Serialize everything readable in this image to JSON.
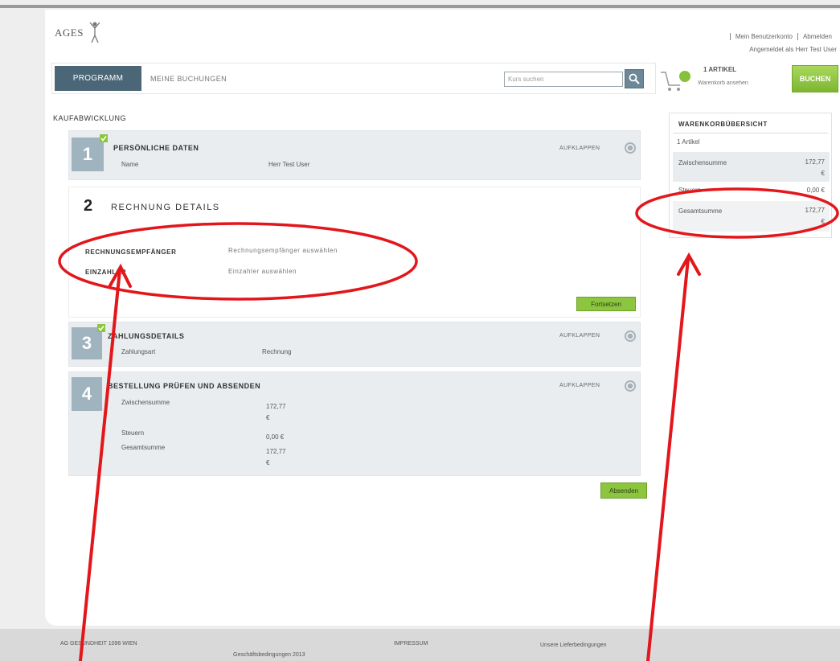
{
  "header": {
    "logo_text": "AGES",
    "account_link": "Mein Benutzerkonto",
    "logout_link": "Abmelden",
    "logged_in_as": "Angemeldet als Herr Test User"
  },
  "nav": {
    "program_button": "PROGRAMM",
    "bookings_link": "MEINE BUCHUNGEN",
    "search_placeholder": "Kurs suchen",
    "cart_count": "1 ARTIKEL",
    "cart_link": "Warenkorb ansehen",
    "book_button": "BUCHEN"
  },
  "page_title": "KAUFABWICKLUNG",
  "steps": [
    {
      "number": "1",
      "title": "PERSÖNLICHE DATEN",
      "toggle_label": "AUFKLAPPEN",
      "rows": [
        {
          "label": "Name",
          "value": "Herr Test User"
        }
      ]
    },
    {
      "number": "2",
      "title": "RECHNUNG DETAILS",
      "fields": [
        {
          "label": "RECHNUNGSEMPFÄNGER",
          "value": "Rechnungsempfänger auswählen"
        },
        {
          "label": "EINZAHLER",
          "value": "Einzahler auswählen"
        }
      ],
      "continue_button": "Fortsetzen"
    },
    {
      "number": "3",
      "title": "ZAHLUNGSDETAILS",
      "toggle_label": "AUFKLAPPEN",
      "rows": [
        {
          "label": "Zahlungsart",
          "value": "Rechnung"
        }
      ]
    },
    {
      "number": "4",
      "title": "BESTELLUNG PRÜFEN UND ABSENDEN",
      "toggle_label": "AUFKLAPPEN",
      "rows": [
        {
          "label": "Zwischensumme",
          "value": "172,77 €"
        },
        {
          "label": "Steuern",
          "value": "0,00 €"
        },
        {
          "label": "Gesamtsumme",
          "value": "172,77 €"
        }
      ]
    }
  ],
  "submit_button": "Absenden",
  "cart_summary": {
    "title": "WARENKORBÜBERSICHT",
    "item_count": "1 Artikel",
    "rows": [
      {
        "label": "Zwischensumme",
        "value": "172,77 €"
      },
      {
        "label": "Steuern",
        "value": "0,00 €"
      },
      {
        "label": "Gesamtsumme",
        "value": "172,77 €"
      }
    ]
  },
  "footer": {
    "address": "AG GESUNDHEIT 1096 WIEN",
    "imprint": "IMPRESSUM",
    "terms_link": "Unsere Lieferbedingungen",
    "general_terms": "Geschäftsbedingungen 2013"
  },
  "colors": {
    "accent_green": "#8cc63f",
    "nav_dark": "#4b6676",
    "annotation_red": "#e3161b"
  }
}
